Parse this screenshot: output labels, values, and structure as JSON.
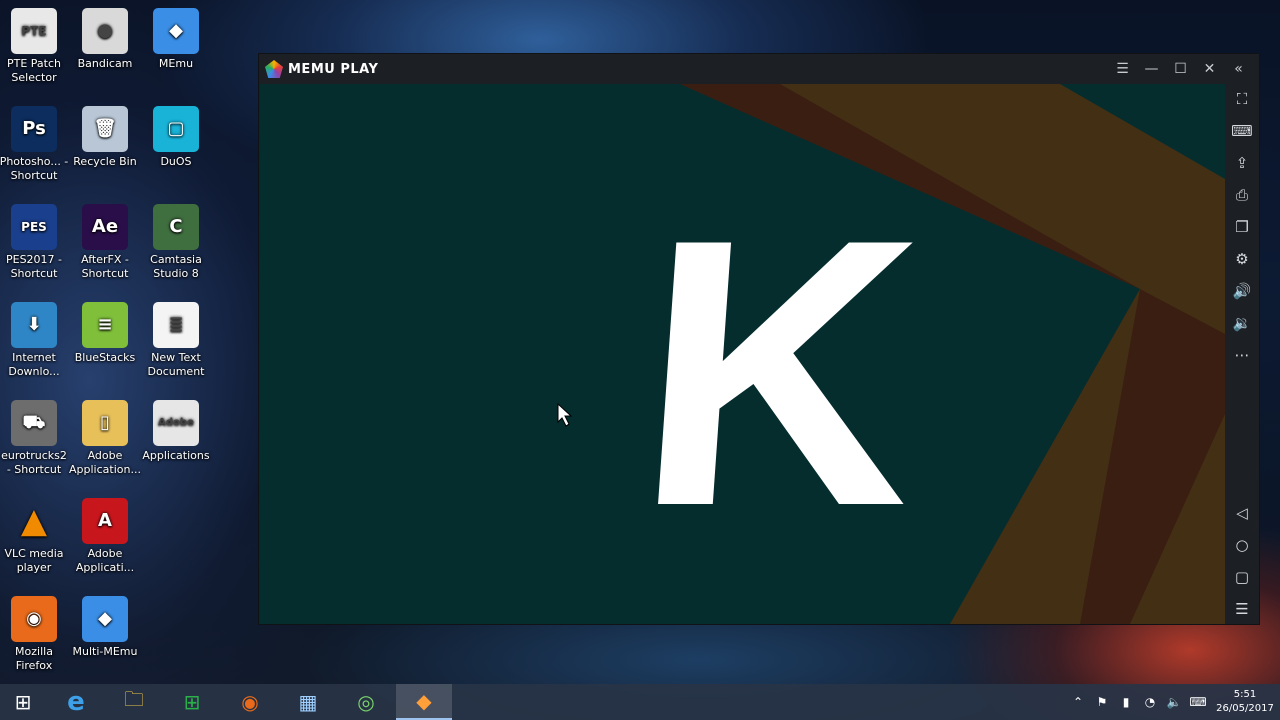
{
  "desktop_icons": [
    {
      "label": "PTE Patch Selector",
      "icon": "pte-patch-icon",
      "bg": "#e8e8e8",
      "glyph": "PTE"
    },
    {
      "label": "Bandicam",
      "icon": "bandicam-icon",
      "bg": "#d9d9d9",
      "glyph": "●"
    },
    {
      "label": "MEmu",
      "icon": "memu-icon",
      "bg": "#3a8ee6",
      "glyph": "◆"
    },
    {
      "label": "Photosho... - Shortcut",
      "icon": "photoshop-icon",
      "bg": "#0c2d5e",
      "glyph": "Ps"
    },
    {
      "label": "Recycle Bin",
      "icon": "recycle-bin-icon",
      "bg": "#b8c6d6",
      "glyph": "🗑"
    },
    {
      "label": "DuOS",
      "icon": "duos-icon",
      "bg": "#19b3d8",
      "glyph": "▢"
    },
    {
      "label": "PES2017 - Shortcut",
      "icon": "pes2017-icon",
      "bg": "#1a3f8c",
      "glyph": "PES"
    },
    {
      "label": "AfterFX - Shortcut",
      "icon": "aftereffects-icon",
      "bg": "#2a0e4a",
      "glyph": "Ae"
    },
    {
      "label": "Camtasia Studio 8",
      "icon": "camtasia-icon",
      "bg": "#3f6e3f",
      "glyph": "C"
    },
    {
      "label": "Internet Downlo...",
      "icon": "internet-download-icon",
      "bg": "#2f86c6",
      "glyph": "⬇"
    },
    {
      "label": "BlueStacks",
      "icon": "bluestacks-icon",
      "bg": "#7fbf3a",
      "glyph": "≡"
    },
    {
      "label": "New Text Document",
      "icon": "text-document-icon",
      "bg": "#f4f4f4",
      "glyph": "≣"
    },
    {
      "label": "eurotrucks2 - Shortcut",
      "icon": "eurotrucks-icon",
      "bg": "#6d6d6d",
      "glyph": "⛟"
    },
    {
      "label": "Adobe Application...",
      "icon": "folder-icon",
      "bg": "#e8c05a",
      "glyph": "▯"
    },
    {
      "label": "Applications",
      "icon": "adobe-application-icon",
      "bg": "#e6e6e6",
      "glyph": "Adobe"
    },
    {
      "label": "VLC media player",
      "icon": "vlc-icon",
      "bg": "transparent",
      "glyph": "▲"
    },
    {
      "label": "Adobe Applicati...",
      "icon": "adobe-acrobat-icon",
      "bg": "#c8161d",
      "glyph": "A"
    },
    {
      "label": "Mozilla Firefox",
      "icon": "firefox-icon",
      "bg": "#e86a1a",
      "glyph": "◉"
    },
    {
      "label": "Multi-MEmu",
      "icon": "multi-memu-icon",
      "bg": "#3a8ee6",
      "glyph": "◆"
    }
  ],
  "memu_window": {
    "logo_text": "MEMU PLAY",
    "controls": [
      {
        "name": "menu-icon",
        "glyph": "☰"
      },
      {
        "name": "minimize-icon",
        "glyph": "—"
      },
      {
        "name": "maximize-icon",
        "glyph": "☐"
      },
      {
        "name": "close-icon",
        "glyph": "✕"
      },
      {
        "name": "collapse-sidebar-icon",
        "glyph": "«"
      }
    ],
    "sidebar_tools": [
      {
        "name": "fullscreen-icon",
        "glyph": "⛶"
      },
      {
        "name": "keyboard-icon",
        "glyph": "⌨"
      },
      {
        "name": "apk-install-icon",
        "glyph": "⇪"
      },
      {
        "name": "screenshot-icon",
        "glyph": "⎙"
      },
      {
        "name": "multi-window-icon",
        "glyph": "❐"
      },
      {
        "name": "settings-icon",
        "glyph": "⚙"
      },
      {
        "name": "volume-up-icon",
        "glyph": "🔊"
      },
      {
        "name": "volume-down-icon",
        "glyph": "🔉"
      },
      {
        "name": "more-icon",
        "glyph": "⋯"
      }
    ],
    "nav_buttons": [
      {
        "name": "back-icon",
        "glyph": "◁"
      },
      {
        "name": "home-icon",
        "glyph": "○"
      },
      {
        "name": "recent-apps-icon",
        "glyph": "▢"
      },
      {
        "name": "menu-list-icon",
        "glyph": "☰"
      }
    ],
    "screen": {
      "background": "#052d2e",
      "splash_letter": "K",
      "stripe_colors": [
        "#3a1e12",
        "#432f14"
      ]
    }
  },
  "taskbar": {
    "items": [
      {
        "name": "start-button",
        "glyph": "⊞",
        "active": false
      },
      {
        "name": "internet-explorer-icon",
        "glyph": "e",
        "active": false
      },
      {
        "name": "file-explorer-icon",
        "glyph": "🗀",
        "active": false
      },
      {
        "name": "store-icon",
        "glyph": "⊞",
        "active": false
      },
      {
        "name": "firefox-taskbar-icon",
        "glyph": "◉",
        "active": false
      },
      {
        "name": "control-panel-icon",
        "glyph": "▦",
        "active": false
      },
      {
        "name": "camtasia-recorder-icon",
        "glyph": "◎",
        "active": false
      },
      {
        "name": "memu-taskbar-icon",
        "glyph": "◆",
        "active": true
      }
    ],
    "tray_icons": [
      {
        "name": "tray-overflow-icon",
        "glyph": "⌃"
      },
      {
        "name": "network-icon",
        "glyph": "⚑"
      },
      {
        "name": "battery-icon",
        "glyph": "▮"
      },
      {
        "name": "wifi-icon",
        "glyph": "◔"
      },
      {
        "name": "speaker-icon",
        "glyph": "🔈"
      },
      {
        "name": "keyboard-language-icon",
        "glyph": "⌨"
      }
    ],
    "clock_time": "5:51",
    "clock_date": "26/05/2017"
  }
}
